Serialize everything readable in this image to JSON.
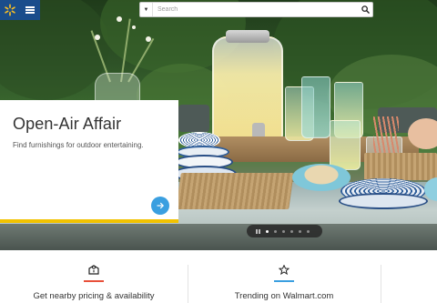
{
  "header": {
    "search": {
      "placeholder": "Search"
    }
  },
  "hero": {
    "promo": {
      "title": "Open-Air Affair",
      "subtitle": "Find furnishings for outdoor entertaining."
    },
    "carousel": {
      "slide_count": 6,
      "active_index": 0
    }
  },
  "features": [
    {
      "label": "Get nearby pricing & availability",
      "icon": "store-pin-icon",
      "accent": "#e8503a"
    },
    {
      "label": "Trending on Walmart.com",
      "icon": "star-icon",
      "accent": "#3a9fe0"
    }
  ],
  "colors": {
    "brand_blue": "#1a4d8c",
    "spark_yellow": "#ffc220",
    "promo_underline": "#f2c200",
    "arrow_blue": "#3a9fe0"
  }
}
